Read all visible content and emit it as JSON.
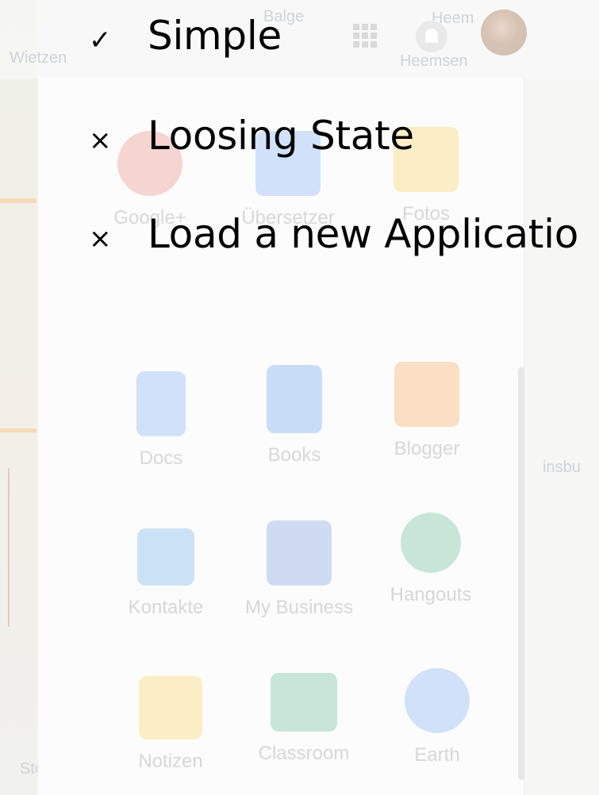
{
  "bullets": [
    {
      "icon": "check-mark",
      "mark": "✓",
      "text": "Simple"
    },
    {
      "icon": "cross-mark",
      "mark": "×",
      "text": "Loosing State"
    },
    {
      "icon": "cross-mark",
      "mark": "×",
      "text": "Load a new Applicatio"
    }
  ],
  "background": {
    "map_labels": {
      "wietzen": "Wietzen",
      "balge": "Balge",
      "heemsen": "Heemsen",
      "heem_partial": "Heem",
      "stolz": "Stolz",
      "insbu": "insbu"
    },
    "apps_row1": [
      {
        "icon": "google-plus-icon",
        "label": "Google+",
        "color": "#dd4b39"
      },
      {
        "icon": "translate-icon",
        "label": "Übersetzer",
        "color": "#4285f4"
      },
      {
        "icon": "photos-icon",
        "label": "Fotos",
        "color": "#fbbc05"
      }
    ],
    "apps_row2": [
      {
        "icon": "docs-icon",
        "label": "Docs",
        "color": "#4285f4"
      },
      {
        "icon": "books-icon",
        "label": "Books",
        "color": "#1a73e8"
      },
      {
        "icon": "blogger-icon",
        "label": "Blogger",
        "color": "#f57d00"
      }
    ],
    "apps_row3": [
      {
        "icon": "contacts-icon",
        "label": "Kontakte",
        "color": "#1e88e5"
      },
      {
        "icon": "my-business-icon",
        "label": "My Business",
        "color": "#3367d6"
      },
      {
        "icon": "hangouts-icon",
        "label": "Hangouts",
        "color": "#0f9d58"
      }
    ],
    "apps_row4": [
      {
        "icon": "keep-icon",
        "label": "Notizen",
        "color": "#fbbc04"
      },
      {
        "icon": "classroom-icon",
        "label": "Classroom",
        "color": "#0f9d58"
      },
      {
        "icon": "earth-icon",
        "label": "Earth",
        "color": "#4285f4"
      }
    ]
  }
}
